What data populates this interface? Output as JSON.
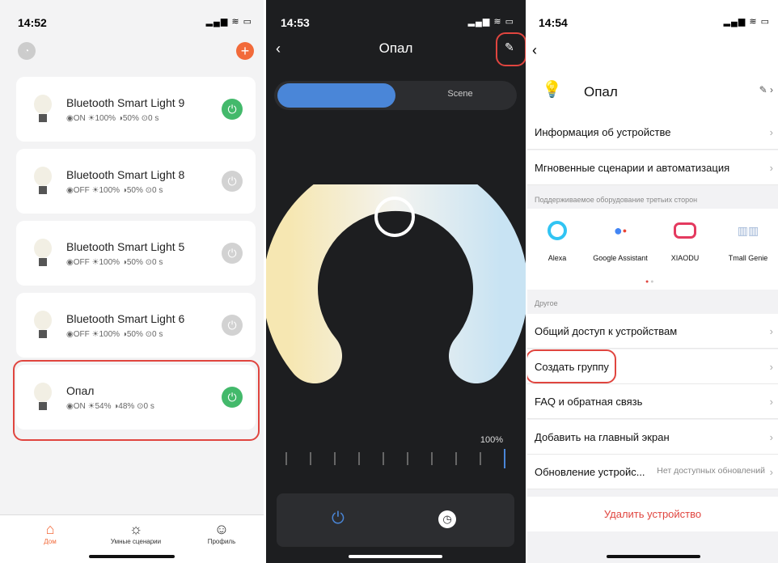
{
  "p1": {
    "time": "14:52",
    "signal": "📶 ≈ ▭",
    "items": [
      {
        "name": "Bluetooth Smart Light 9",
        "status": "◉ON ☀100% ◑50% ⊙0 s",
        "on": true
      },
      {
        "name": "Bluetooth Smart Light 8",
        "status": "◉OFF ☀100% ◑50% ⊙0 s",
        "on": false
      },
      {
        "name": "Bluetooth Smart Light 5",
        "status": "◉OFF ☀100% ◑50% ⊙0 s",
        "on": false
      },
      {
        "name": "Bluetooth Smart Light 6",
        "status": "◉OFF ☀100% ◑50% ⊙0 s",
        "on": false
      },
      {
        "name": "Опал",
        "status": "◉ON ☀54% ◑48% ⊙0 s",
        "on": true
      }
    ],
    "tabs": [
      {
        "label": "Дом"
      },
      {
        "label": "Умные сценарии"
      },
      {
        "label": "Профиль"
      }
    ]
  },
  "p2": {
    "time": "14:53",
    "title": "Опал",
    "tab_left": "",
    "tab_right": "Scene",
    "brightness_label": "100%",
    "brightness": 1.0
  },
  "p3": {
    "time": "14:54",
    "device_name": "Опал",
    "rows1": [
      {
        "label": "Информация об устройстве"
      },
      {
        "label": "Мгновенные сценарии и автоматизация"
      }
    ],
    "third_party_header": "Поддерживаемое оборудование третьих сторон",
    "assistants": [
      {
        "label": "Alexa"
      },
      {
        "label": "Google Assistant"
      },
      {
        "label": "XIAODU"
      },
      {
        "label": "Tmall Genie"
      }
    ],
    "other_header": "Другое",
    "rows2": [
      {
        "label": "Общий доступ к устройствам"
      },
      {
        "label": "Создать группу"
      },
      {
        "label": "FAQ и обратная связь"
      },
      {
        "label": "Добавить на главный экран"
      },
      {
        "label": "Обновление устройс..."
      }
    ],
    "update_value": "Нет доступных обновлений",
    "delete_label": "Удалить устройство"
  },
  "colors": {
    "green": "#43b96b",
    "red": "#e0453f",
    "blue": "#4a86d8",
    "orange": "#f26a3a"
  }
}
